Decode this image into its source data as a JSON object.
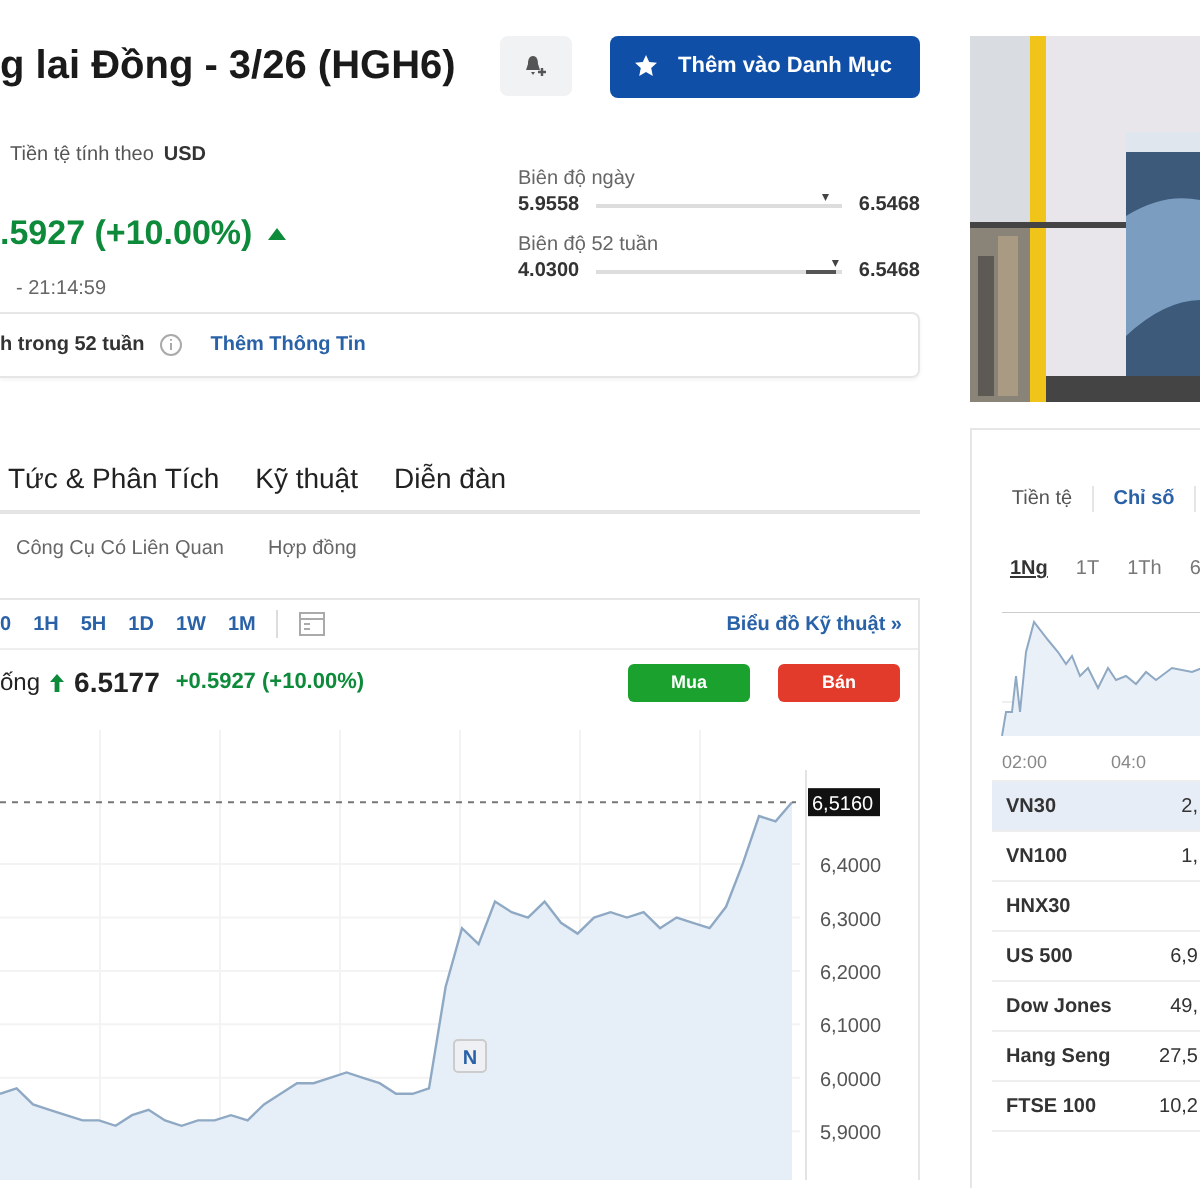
{
  "header": {
    "title": "g lai Đồng - 3/26 (HGH6)",
    "watchlist_button": "Thêm vào Danh Mục"
  },
  "currency": {
    "label": "Tiền tệ tính theo",
    "value": "USD"
  },
  "price": {
    "change": ".5927 (+10.00%)",
    "time": "- 21:14:59"
  },
  "ranges": [
    {
      "label": "Biên độ ngày",
      "low": "5.9558",
      "high": "6.5468",
      "level": 0.93
    },
    {
      "label": "Biên độ 52 tuần",
      "low": "4.0300",
      "high": "6.5468",
      "level": 0.97
    }
  ],
  "info_bar": {
    "text": "h trong 52 tuần",
    "link": "Thêm Thông Tin"
  },
  "tabs": [
    {
      "label": "Tức & Phân Tích",
      "selected": false
    },
    {
      "label": "Kỹ thuật",
      "selected": false
    },
    {
      "label": "Diễn đàn",
      "selected": false
    }
  ],
  "subtabs": [
    {
      "label": "Công Cụ Có Liên Quan",
      "selected": false
    },
    {
      "label": "Hợp đồng",
      "selected": false
    }
  ],
  "chart": {
    "periods": [
      "0",
      "1H",
      "5H",
      "1D",
      "1W",
      "1M"
    ],
    "technical_link": "Biểu đồ Kỹ thuật »",
    "quote": {
      "name": "ống",
      "last": "6.5177",
      "change": "+0.5927 (+10.00%)"
    },
    "buy_button": "Mua",
    "sell_button": "Bán",
    "price_tag": "6,5160",
    "marker": "N",
    "axis_labels": [
      "6,4000",
      "6,3000",
      "6,2000",
      "6,1000",
      "6,0000",
      "5,9000"
    ]
  },
  "side": {
    "photo": {
      "kind": "picture"
    },
    "tabs": [
      {
        "label": "Tiền tệ",
        "selected": false
      },
      {
        "label": "Chỉ số",
        "selected": true
      }
    ],
    "periods": [
      {
        "label": "1Ng",
        "selected": true
      },
      {
        "label": "1T",
        "selected": false
      },
      {
        "label": "1Th",
        "selected": false
      },
      {
        "label": "6",
        "selected": false
      }
    ],
    "time_labels": [
      "02:00",
      "04:0"
    ],
    "rows": [
      {
        "name": "VN30",
        "value": "2,",
        "selected": true
      },
      {
        "name": "VN100",
        "value": "1,",
        "selected": false
      },
      {
        "name": "HNX30",
        "selected": false
      },
      {
        "name": "US 500",
        "value": "6,9",
        "selected": false
      },
      {
        "name": "Dow Jones",
        "value": "49,",
        "selected": false
      },
      {
        "name": "Hang Seng",
        "value": "27,5",
        "selected": false
      },
      {
        "name": "FTSE 100",
        "value": "10,2",
        "selected": false
      }
    ]
  }
}
